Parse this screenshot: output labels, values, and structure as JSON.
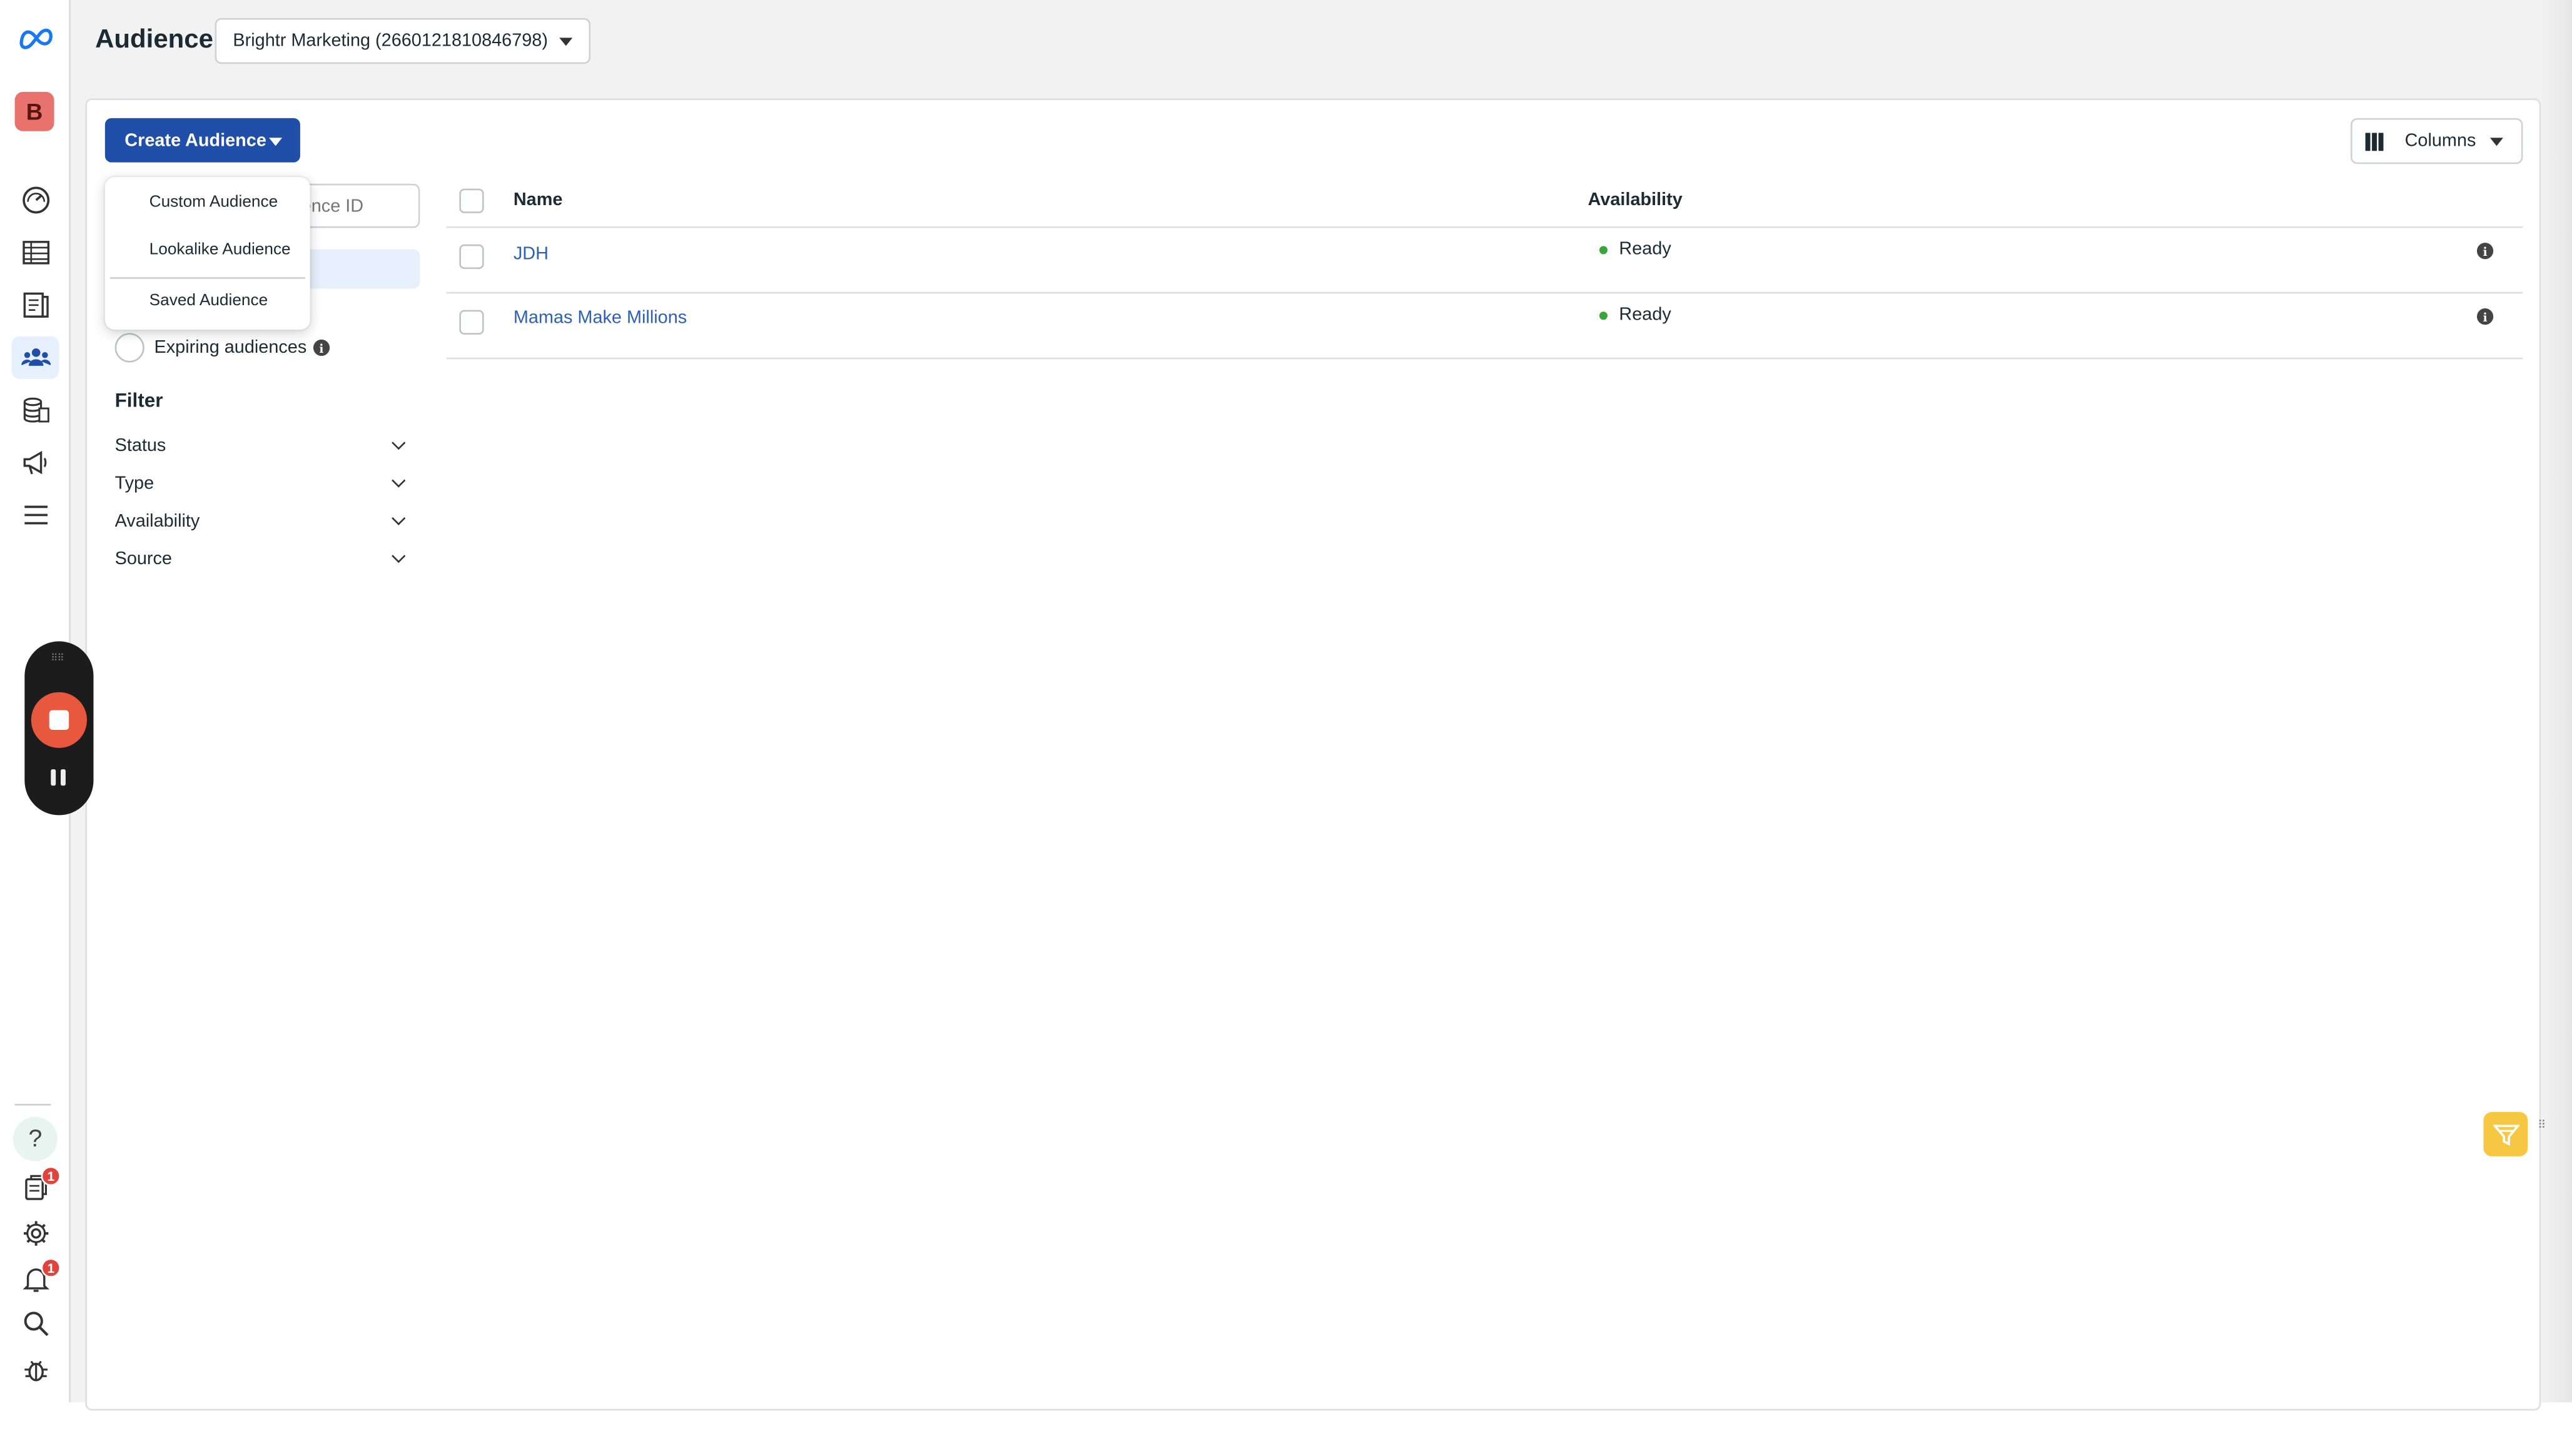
{
  "header": {
    "title": "Audience",
    "account_selector": "Brightr Marketing (2660121810846798)"
  },
  "toolbar": {
    "create_label": "Create Audience",
    "columns_label": "Columns"
  },
  "create_menu": {
    "items": [
      "Custom Audience",
      "Lookalike Audience",
      "Saved Audience"
    ]
  },
  "sidebar_filters": {
    "search_placeholder": "udience ID",
    "expiring_label": "Expiring audiences",
    "filter_title": "Filter",
    "items": [
      "Status",
      "Type",
      "Availability",
      "Source"
    ]
  },
  "table": {
    "columns": [
      "Name",
      "Availability"
    ],
    "rows": [
      {
        "name": "JDH",
        "availability": "Ready"
      },
      {
        "name": "Mamas Make Millions",
        "availability": "Ready"
      }
    ]
  },
  "rail": {
    "account_initial": "B",
    "help_glyph": "?",
    "notif_badge_1": "1",
    "notif_badge_2": "1"
  },
  "colors": {
    "primary": "#1f4fa8",
    "link": "#2d5fb5",
    "ready": "#3ba53b",
    "record": "#e8583f",
    "feedback": "#f7c744"
  }
}
